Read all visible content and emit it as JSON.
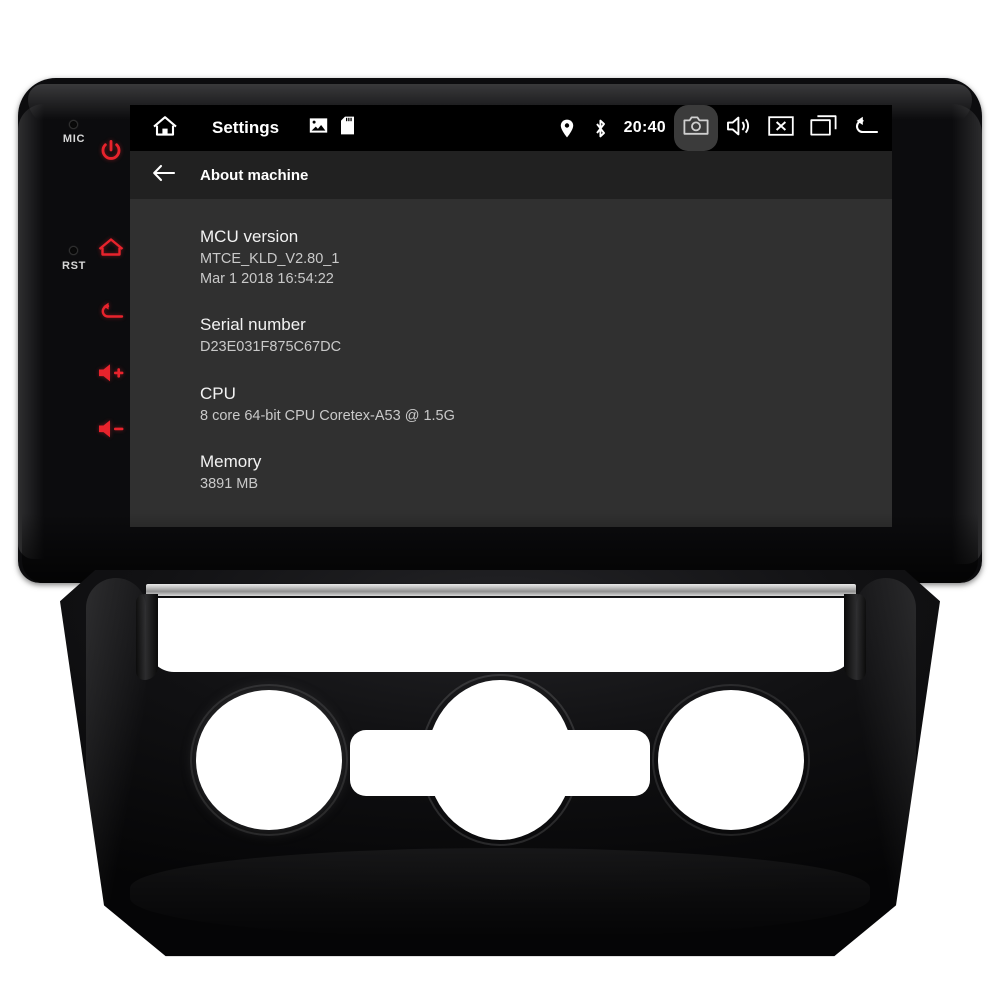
{
  "device": {
    "hardware_buttons": [
      {
        "name": "power",
        "icon": "power-icon"
      },
      {
        "name": "home",
        "icon": "home-icon"
      },
      {
        "name": "back",
        "icon": "back-icon"
      },
      {
        "name": "volume-up",
        "icon": "volume-up-icon"
      },
      {
        "name": "volume-down",
        "icon": "volume-down-icon"
      }
    ],
    "labels": {
      "mic": "MIC",
      "reset": "RST"
    },
    "accent_color": "#e8232c"
  },
  "screen": {
    "background_color": "#303030",
    "statusbar": {
      "background_color": "#000000",
      "home_icon": "home-icon",
      "title": "Settings",
      "mini_icons": [
        {
          "name": "gallery-icon",
          "label": "Gallery"
        },
        {
          "name": "sd-card-icon",
          "label": "SD Card"
        }
      ],
      "indicators": [
        {
          "name": "location-icon",
          "label": "Location"
        },
        {
          "name": "bluetooth-icon",
          "label": "Bluetooth"
        }
      ],
      "clock": "20:40",
      "buttons": [
        {
          "name": "screenshot-button",
          "icon": "camera-icon",
          "label": "Screenshot",
          "highlighted": true
        },
        {
          "name": "volume-button",
          "icon": "speaker-icon",
          "label": "Volume"
        },
        {
          "name": "close-button",
          "icon": "close-box-icon",
          "label": "Close"
        },
        {
          "name": "recents-button",
          "icon": "recents-icon",
          "label": "Recent apps"
        },
        {
          "name": "back-button",
          "icon": "back-arrow-icon",
          "label": "Back"
        }
      ]
    },
    "actionbar": {
      "background_color": "#212121",
      "back_icon": "arrow-left-icon",
      "title": "About machine"
    },
    "items": [
      {
        "title": "MCU version",
        "lines": [
          "MTCE_KLD_V2.80_1",
          "Mar  1 2018 16:54:22"
        ]
      },
      {
        "title": "Serial number",
        "lines": [
          "D23E031F875C67DC"
        ]
      },
      {
        "title": "CPU",
        "lines": [
          "8 core 64-bit CPU Coretex-A53 @ 1.5G"
        ]
      },
      {
        "title": "Memory",
        "lines": [
          "3891 MB"
        ]
      }
    ]
  }
}
